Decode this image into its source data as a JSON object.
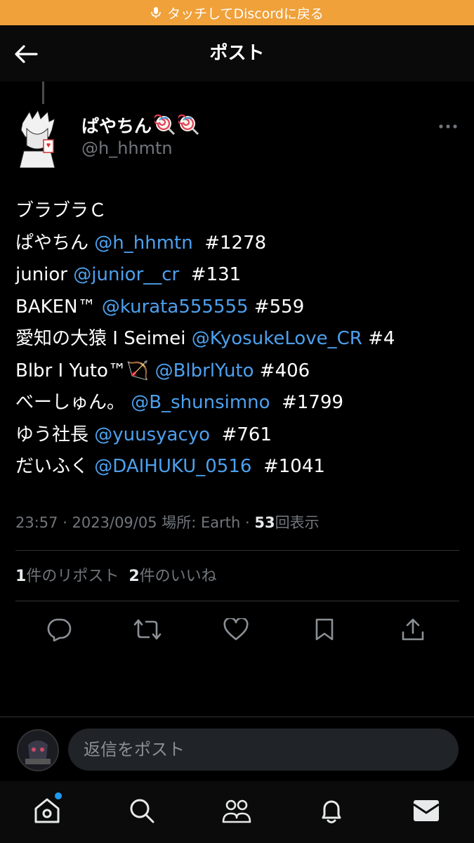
{
  "banner": {
    "text": "タッチしてDiscordに戻る",
    "icon": "microphone-icon",
    "color": "#f0a13a"
  },
  "header": {
    "title": "ポスト",
    "back_icon": "arrow-left-icon"
  },
  "author": {
    "display_name": "ぱやちん",
    "emoji": [
      "lollipop",
      "lollipop"
    ],
    "handle": "@h_hhmtn"
  },
  "post": {
    "lines": [
      {
        "text": "ブラブラＣ",
        "mention": "",
        "suffix": ""
      },
      {
        "text": "ぱやちん ",
        "mention": "@h_hhmtn",
        "suffix": "  #1278"
      },
      {
        "text": "junior ",
        "mention": "@junior__cr",
        "suffix": "  #131"
      },
      {
        "text": "BAKEN™ ",
        "mention": "@kurata555555",
        "suffix": " #559"
      },
      {
        "text": "愛知の大猿 I Seimei ",
        "mention": "@KyosukeLove_CR",
        "suffix": " #4"
      },
      {
        "text": "Blbr I Yuto™🏹 ",
        "mention": "@BlbrlYuto",
        "suffix": " #406"
      },
      {
        "text": "べーしゅん。 ",
        "mention": "@B_shunsimno",
        "suffix": "  #1799"
      },
      {
        "text": "ゆう社長 ",
        "mention": "@yuusyacyo",
        "suffix": "  #761"
      },
      {
        "text": "だいふく ",
        "mention": "@DAIHUKU_0516",
        "suffix": "  #1041"
      }
    ]
  },
  "meta": {
    "time": "23:57 · 2023/09/05 場所: Earth · ",
    "views_count": "53",
    "views_label": "回表示"
  },
  "stats": {
    "reposts_count": "1",
    "reposts_label": "件のリポスト",
    "likes_count": "2",
    "likes_label": "件のいいね"
  },
  "actions": [
    "reply-icon",
    "repost-icon",
    "like-icon",
    "bookmark-icon",
    "share-icon"
  ],
  "reply": {
    "placeholder": "返信をポスト"
  },
  "tabbar": [
    "home-icon",
    "search-icon",
    "communities-icon",
    "notifications-icon",
    "messages-icon"
  ],
  "colors": {
    "accent": "#1d9bf0",
    "mention": "#4da0ee",
    "banner": "#f0a13a"
  }
}
